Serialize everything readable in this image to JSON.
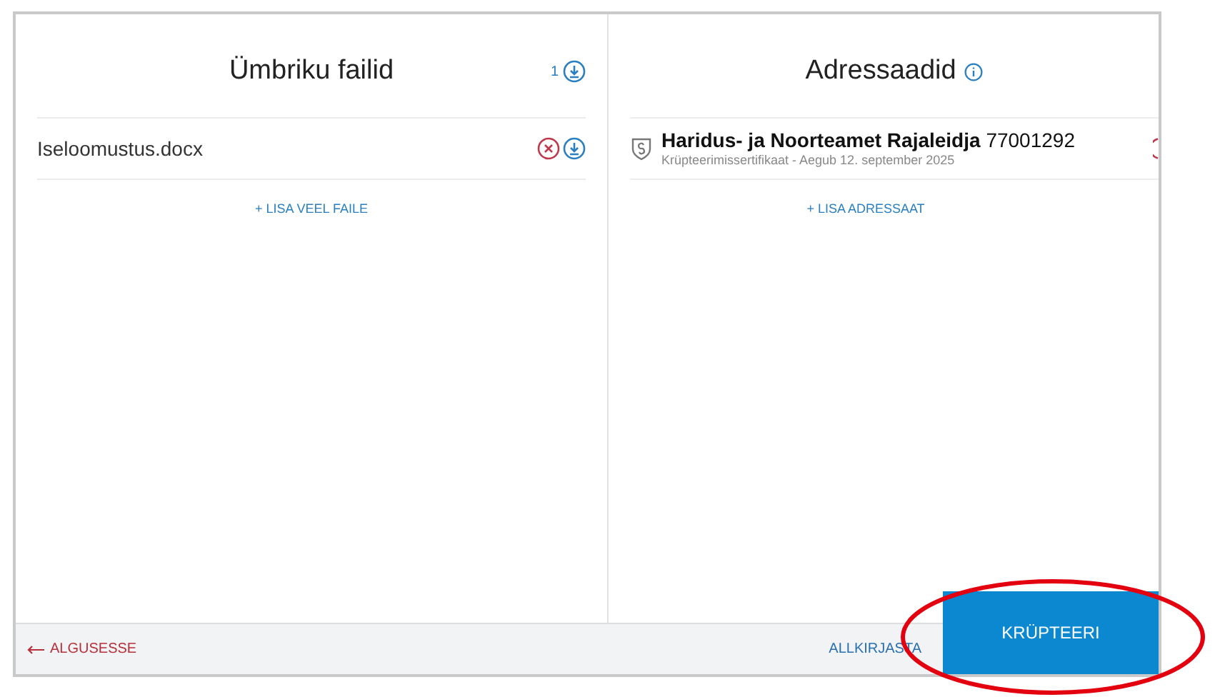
{
  "files_panel": {
    "title": "Ümbriku failid",
    "count": "1",
    "files": [
      {
        "name": "Iseloomustus.docx"
      }
    ],
    "add_link": "+ LISA VEEL FAILE"
  },
  "recipients_panel": {
    "title": "Adressaadid",
    "recipients": [
      {
        "name": "Haridus- ja Noorteamet Rajaleidja",
        "code": "77001292",
        "detail": "Krüpteerimissertifikaat - Aegub 12. september 2025"
      }
    ],
    "add_link": "+ LISA ADRESSAAT"
  },
  "footer": {
    "back": "ALGUSESSE",
    "sign": "ALLKIRJASTA",
    "encrypt": "KRÜPTEERI"
  }
}
